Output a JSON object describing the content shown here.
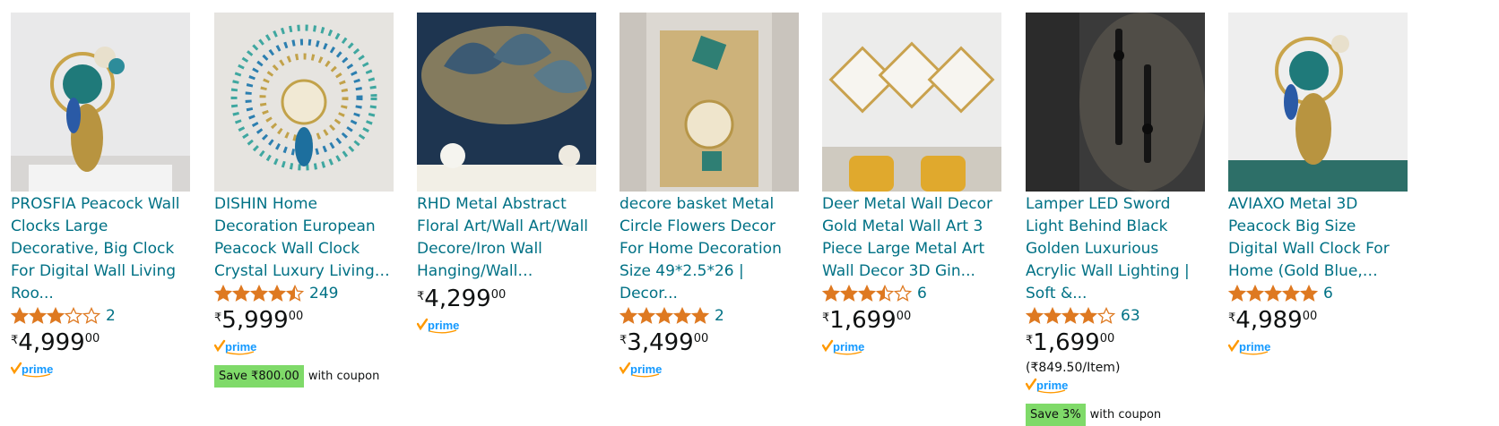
{
  "colors": {
    "link": "#007185",
    "star": "#DE7921",
    "coupon_bg": "#7FDA69",
    "prime": "#FF9900",
    "prime_text": "#1399FF"
  },
  "products": [
    {
      "title": "PROSFIA Peacock Wall Clocks Large Decorative, Big Clock For Digital Wall Living Roo...",
      "rating": 3,
      "reviews": "2",
      "currency": "₹",
      "price_whole": "4,999",
      "price_frac": "00",
      "unit_price": "",
      "prime": "prime",
      "coupon_badge": "",
      "coupon_text": "",
      "image": "peacock-clock-room"
    },
    {
      "title": "DISHIN Home Decoration European Peacock Wall Clock Crystal Luxury Living…",
      "rating": 4.5,
      "reviews": "249",
      "currency": "₹",
      "price_whole": "5,999",
      "price_frac": "00",
      "unit_price": "",
      "prime": "prime",
      "coupon_badge": "Save ₹800.00",
      "coupon_text": "with coupon",
      "image": "peacock-fan-clock"
    },
    {
      "title": "RHD Metal Abstract Floral Art/Wall Art/Wall Decore/Iron Wall Hanging/Wall…",
      "rating": null,
      "reviews": "",
      "currency": "₹",
      "price_whole": "4,299",
      "price_frac": "00",
      "unit_price": "",
      "prime": "prime",
      "coupon_badge": "",
      "coupon_text": "",
      "image": "metal-leaf-art"
    },
    {
      "title": "decore basket Metal Circle Flowers Decor For Home Decoration Size 49*2.5*26 | Decor...",
      "rating": 5,
      "reviews": "2",
      "currency": "₹",
      "price_whole": "3,499",
      "price_frac": "00",
      "unit_price": "",
      "prime": "prime",
      "coupon_badge": "",
      "coupon_text": "",
      "image": "gold-flower-clock"
    },
    {
      "title": "Deer Metal Wall Decor Gold Metal Wall Art 3 Piece Large Metal Art Wall Decor 3D Gin...",
      "rating": 3.5,
      "reviews": "6",
      "currency": "₹",
      "price_whole": "1,699",
      "price_frac": "00",
      "unit_price": "",
      "prime": "prime",
      "coupon_badge": "",
      "coupon_text": "",
      "image": "deer-wall-art"
    },
    {
      "title": "Lamper LED Sword Light Behind Black Golden Luxurious Acrylic Wall Lighting | Soft &...",
      "rating": 4,
      "reviews": "63",
      "currency": "₹",
      "price_whole": "1,699",
      "price_frac": "00",
      "unit_price": "(₹849.50/Item)",
      "prime": "prime",
      "coupon_badge": "Save 3%",
      "coupon_text": "with coupon",
      "image": "sword-light"
    },
    {
      "title": "AVIAXO Metal 3D Peacock Big Size Digital Wall Clock For Home (Gold Blue,…",
      "rating": 5,
      "reviews": "6",
      "currency": "₹",
      "price_whole": "4,989",
      "price_frac": "00",
      "unit_price": "",
      "prime": "prime",
      "coupon_badge": "",
      "coupon_text": "",
      "image": "peacock-clock-room"
    }
  ]
}
